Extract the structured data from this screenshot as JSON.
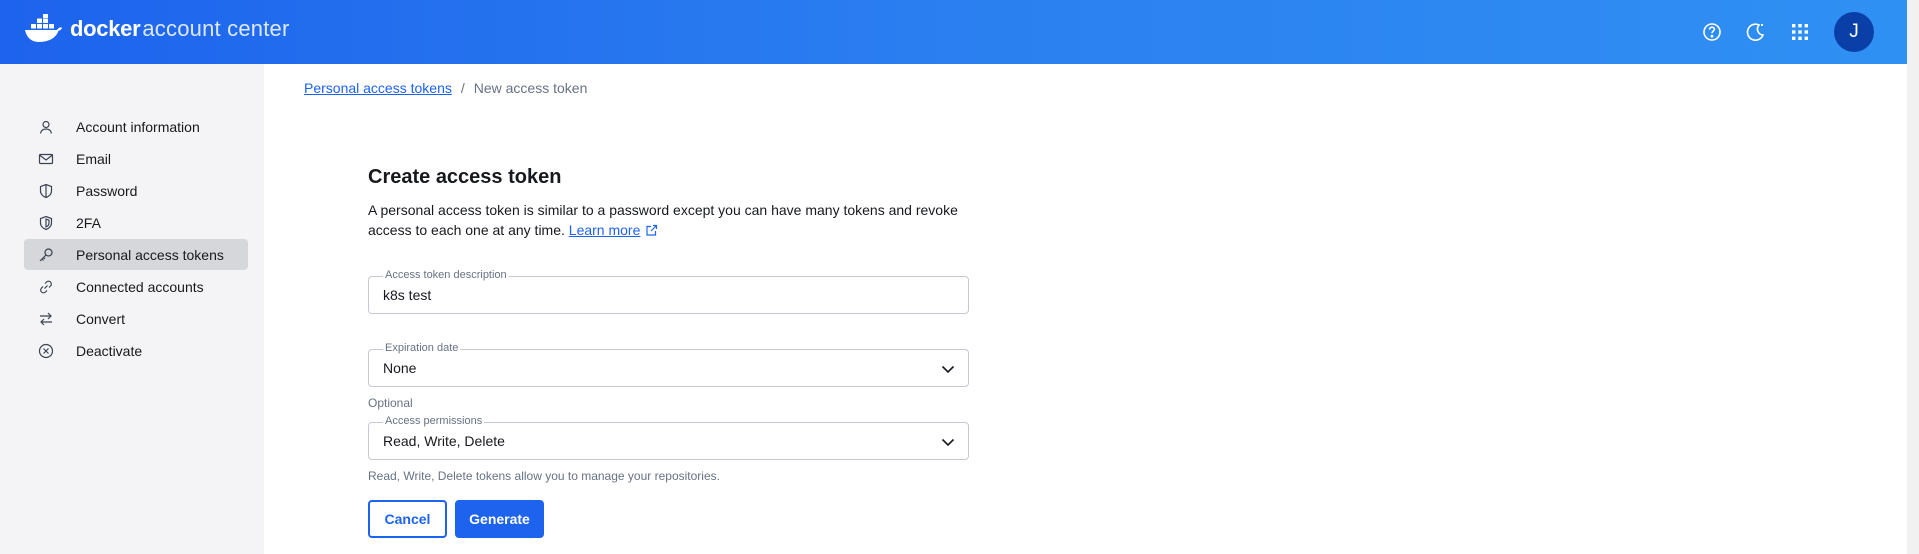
{
  "header": {
    "brand": "docker",
    "product": "account center",
    "avatar_initial": "J",
    "icons": [
      "help-circle-icon",
      "theme-toggle-icon",
      "apps-grid-icon"
    ],
    "colors": {
      "gradient_start": "#1d63ed",
      "gradient_end": "#2f90f3",
      "avatar_bg": "#0b3fa8"
    }
  },
  "sidebar": {
    "items": [
      {
        "label": "Account information",
        "icon": "user-icon",
        "active": false
      },
      {
        "label": "Email",
        "icon": "mail-icon",
        "active": false
      },
      {
        "label": "Password",
        "icon": "shield-icon",
        "active": false
      },
      {
        "label": "2FA",
        "icon": "shield-check-icon",
        "active": false
      },
      {
        "label": "Personal access tokens",
        "icon": "key-icon",
        "active": true
      },
      {
        "label": "Connected accounts",
        "icon": "link-icon",
        "active": false
      },
      {
        "label": "Convert",
        "icon": "swap-icon",
        "active": false
      },
      {
        "label": "Deactivate",
        "icon": "x-circle-icon",
        "active": false
      }
    ]
  },
  "breadcrumb": {
    "parent": "Personal access tokens",
    "separator": "/",
    "current": "New access token"
  },
  "form": {
    "title": "Create access token",
    "description": "A personal access token is similar to a password except you can have many tokens and revoke access to each one at any time.",
    "learn_more": "Learn more",
    "token_description": {
      "label": "Access token description",
      "value": "k8s test"
    },
    "expiration": {
      "label": "Expiration date",
      "value": "None",
      "helper": "Optional"
    },
    "permissions": {
      "label": "Access permissions",
      "value": "Read, Write, Delete",
      "helper": "Read, Write, Delete tokens allow you to manage your repositories."
    },
    "cancel_label": "Cancel",
    "generate_label": "Generate",
    "accent_color": "#1d63ed"
  }
}
